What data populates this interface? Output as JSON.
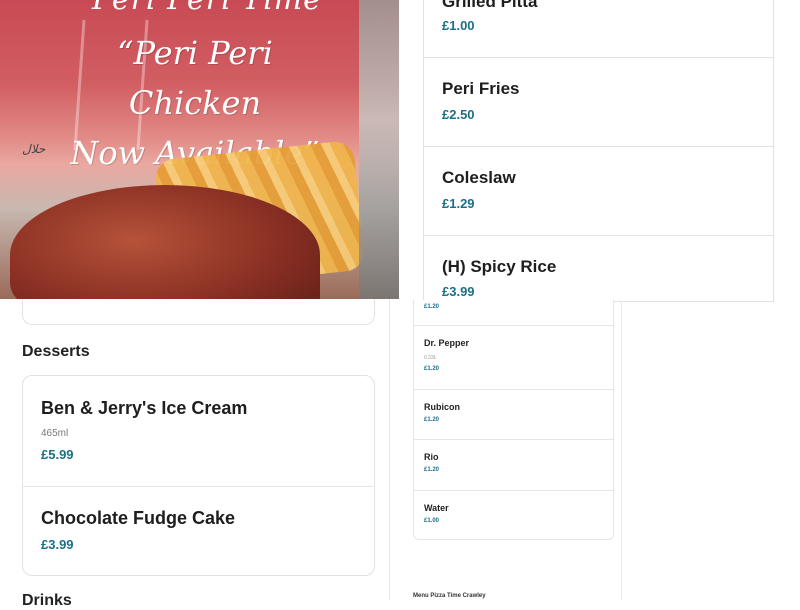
{
  "promo": {
    "header_text": "Peri Peri Time",
    "headline_line1": "“Peri Peri Chicken",
    "headline_line2": "Now Available”",
    "halal_mark": "حلال"
  },
  "sections": {
    "desserts_title": "Desserts",
    "drinks_title": "Drinks"
  },
  "desserts": [
    {
      "name": "Ben & Jerry's Ice Cream",
      "desc": "465ml",
      "price": "£5.99"
    },
    {
      "name": "Chocolate Fudge Cake",
      "desc": "",
      "price": "£3.99"
    }
  ],
  "sides": [
    {
      "name": "Grilled Pitta",
      "price": "£1.00"
    },
    {
      "name": "Peri Fries",
      "price": "£2.50"
    },
    {
      "name": "Coleslaw",
      "price": "£1.29"
    },
    {
      "name": "(H) Spicy Rice",
      "price": "£3.99"
    }
  ],
  "drinks": [
    {
      "name": "",
      "desc": "",
      "price": "£1.20"
    },
    {
      "name": "Dr. Pepper",
      "desc": "0.33L",
      "price": "£1.20"
    },
    {
      "name": "Rubicon",
      "desc": "",
      "price": "£1.20"
    },
    {
      "name": "Rio",
      "desc": "",
      "price": "£1.20"
    },
    {
      "name": "Water",
      "desc": "",
      "price": "£1.00"
    }
  ],
  "footer": {
    "text": "Menu Pizza Time Crawley"
  },
  "colors": {
    "price": "#1c6f86",
    "border": "#e2e2e2",
    "promo_red": "#c94a52"
  }
}
